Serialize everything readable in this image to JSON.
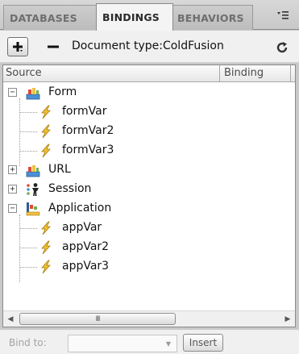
{
  "tabs": [
    {
      "label": "DATABASES",
      "active": false
    },
    {
      "label": "BINDINGS",
      "active": true
    },
    {
      "label": "BEHAVIORS",
      "active": false
    }
  ],
  "tab_menu_icon": "panel-options-menu-icon",
  "toolbar": {
    "add_icon": "plus-icon",
    "remove_icon": "minus-icon",
    "document_type": "Document type:ColdFusion",
    "refresh_icon": "refresh-icon"
  },
  "columns": {
    "source": "Source",
    "binding": "Binding"
  },
  "tree": [
    {
      "label": "Form",
      "icon": "form-icon",
      "expanded": true,
      "children": [
        {
          "label": "formVar",
          "icon": "variable-bolt-icon"
        },
        {
          "label": "formVar2",
          "icon": "variable-bolt-icon"
        },
        {
          "label": "formVar3",
          "icon": "variable-bolt-icon"
        }
      ]
    },
    {
      "label": "URL",
      "icon": "url-icon",
      "expanded": false,
      "children": []
    },
    {
      "label": "Session",
      "icon": "session-icon",
      "expanded": false,
      "children": []
    },
    {
      "label": "Application",
      "icon": "application-icon",
      "expanded": true,
      "children": [
        {
          "label": "appVar",
          "icon": "variable-bolt-icon"
        },
        {
          "label": "appVar2",
          "icon": "variable-bolt-icon"
        },
        {
          "label": "appVar3",
          "icon": "variable-bolt-icon"
        }
      ]
    }
  ],
  "scrollbar": {
    "thumb_grip": "III"
  },
  "footer": {
    "bind_to_label": "Bind to:",
    "bind_to_value": "",
    "insert_label": "Insert"
  }
}
